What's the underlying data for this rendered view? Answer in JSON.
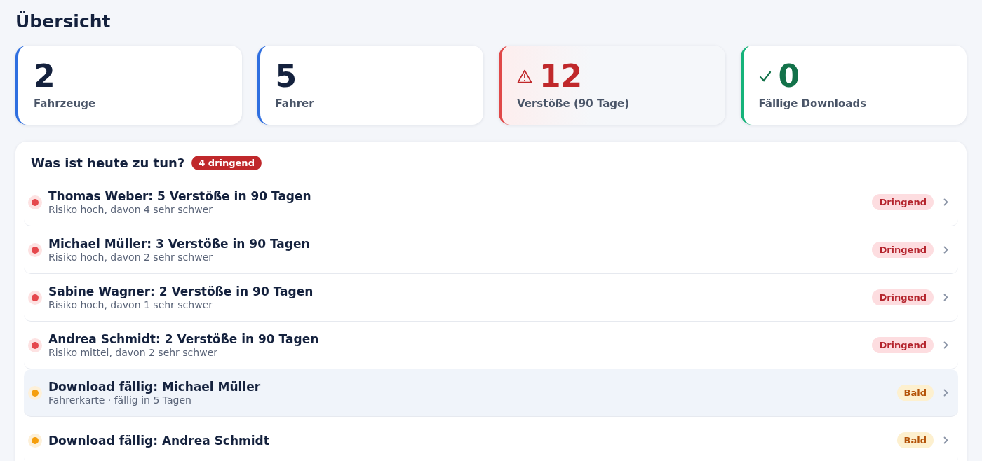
{
  "title": "Übersicht",
  "stats": [
    {
      "kind": "info",
      "value": "2",
      "label": "Fahrzeuge"
    },
    {
      "kind": "info",
      "value": "5",
      "label": "Fahrer"
    },
    {
      "kind": "alert",
      "value": "12",
      "label": "Verstöße (90 Tage)"
    },
    {
      "kind": "ok",
      "value": "0",
      "label": "Fällige Downloads"
    }
  ],
  "tasks": {
    "title": "Was ist heute zu tun?",
    "badge": "4 dringend",
    "items": [
      {
        "kind": "urgent",
        "selected": false,
        "title": "Thomas Weber: 5 Verstöße in 90 Tagen",
        "subtitle": "Risiko hoch, davon 4 sehr schwer",
        "tag": "Dringend"
      },
      {
        "kind": "urgent",
        "selected": false,
        "title": "Michael Müller: 3 Verstöße in 90 Tagen",
        "subtitle": "Risiko hoch, davon 2 sehr schwer",
        "tag": "Dringend"
      },
      {
        "kind": "urgent",
        "selected": false,
        "title": "Sabine Wagner: 2 Verstöße in 90 Tagen",
        "subtitle": "Risiko hoch, davon 1 sehr schwer",
        "tag": "Dringend"
      },
      {
        "kind": "urgent",
        "selected": false,
        "title": "Andrea Schmidt: 2 Verstöße in 90 Tagen",
        "subtitle": "Risiko mittel, davon 2 sehr schwer",
        "tag": "Dringend"
      },
      {
        "kind": "soon",
        "selected": true,
        "title": "Download fällig: Michael Müller",
        "subtitle": "Fahrerkarte · fällig in 5 Tagen",
        "tag": "Bald"
      },
      {
        "kind": "soon",
        "selected": false,
        "title": "Download fällig: Andrea Schmidt",
        "tag": "Bald"
      }
    ]
  }
}
